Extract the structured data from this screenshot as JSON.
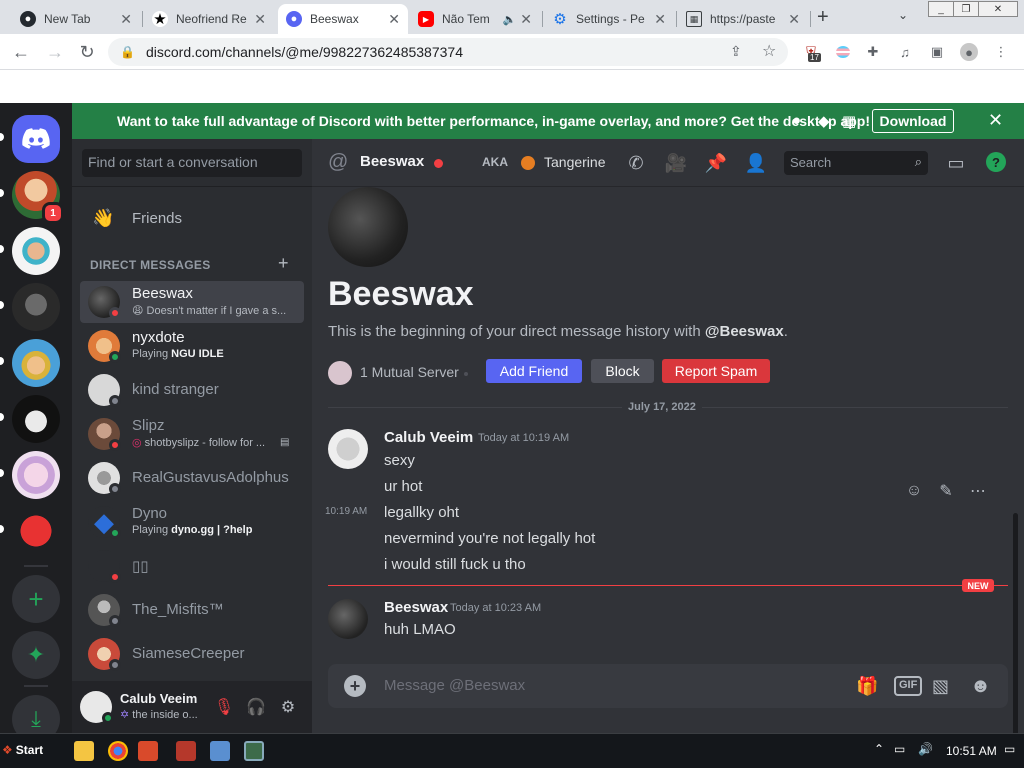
{
  "browser": {
    "tabs": [
      {
        "title": "New Tab",
        "icon": "github-icon",
        "color": "#24292f"
      },
      {
        "title": "Neofriend Re",
        "icon": "star-icon",
        "color": "#000000"
      },
      {
        "title": "Beeswax",
        "icon": "discord-icon",
        "color": "#5865f2"
      },
      {
        "title": "Não Tem",
        "icon": "youtube-icon",
        "color": "#ff0000"
      },
      {
        "title": "Settings - Pe",
        "icon": "gear-icon",
        "color": "#1a73e8"
      },
      {
        "title": "https://paste",
        "icon": "pastebin-icon",
        "color": "#3c4043"
      }
    ],
    "url": "discord.com/channels/@me/998227362485387374",
    "ext_badge": "17"
  },
  "banner": {
    "text": "Want to take full advantage of Discord with better performance, in-game overlay, and more? Get the desktop app!",
    "download": "Download"
  },
  "guilds": {
    "home_icon": "discord-icon",
    "badge": "1",
    "add_icon": "plus-icon",
    "explore_icon": "compass-icon",
    "download_icon": "download-icon"
  },
  "dm_panel": {
    "search_placeholder": "Find or start a conversation",
    "friends_label": "Friends",
    "header": "DIRECT MESSAGES",
    "dms": [
      {
        "name": "Beeswax",
        "sub": "Doesn't matter if I gave a s...",
        "status": "dnd",
        "avatar": "#3a3a3a",
        "selected": true
      },
      {
        "name": "nyxdote",
        "sub_prefix": "Playing",
        "sub_bold": "NGU IDLE",
        "status": "online",
        "avatar": "#e07b3a"
      },
      {
        "name": "kind stranger",
        "status": "offline",
        "avatar": "#d8d8d8"
      },
      {
        "name": "Slipz",
        "sub": "shotbyslipz - follow for ...",
        "status": "dnd",
        "avatar": "#6b4a3a"
      },
      {
        "name": "RealGustavusAdolphus",
        "status": "offline",
        "avatar": "#bfbfbf"
      },
      {
        "name": "Dyno",
        "sub_prefix": "Playing",
        "sub_bold": "dyno.gg | ?help",
        "status": "online",
        "avatar": "#2c6ed9"
      },
      {
        "name": "▯▯",
        "status": "dnd",
        "avatar": "#2b2d31"
      },
      {
        "name": "The_Misfits™",
        "status": "offline",
        "avatar": "#555555"
      },
      {
        "name": "SiameseCreeper",
        "status": "offline",
        "avatar": "#c94a3a"
      }
    ]
  },
  "user_panel": {
    "name": "Calub Veeim",
    "status": "the inside o...",
    "mute_icon": "microphone-muted-icon",
    "deafen_icon": "headphones-icon",
    "settings_icon": "gear-icon"
  },
  "chat": {
    "header": {
      "name": "Beeswax",
      "aka": "AKA",
      "aka_name": "Tangerine",
      "search_placeholder": "Search"
    },
    "welcome": {
      "title": "Beeswax",
      "desc_prefix": "This is the beginning of your direct message history with ",
      "desc_bold": "@Beeswax",
      "desc_suffix": ".",
      "mutual": "1 Mutual Server",
      "add_friend": "Add Friend",
      "block": "Block",
      "report": "Report Spam"
    },
    "date_divider": "July 17, 2022",
    "new_tag": "NEW",
    "hover_time": "10:19 AM",
    "messages": [
      {
        "author": "Calub Veeim",
        "timestamp": "Today at 10:19 AM",
        "lines": [
          "sexy",
          "ur hot",
          "legallky oht",
          "nevermind you're not legally hot",
          "i would still fuck u tho"
        ]
      },
      {
        "author": "Beeswax",
        "timestamp": "Today at 10:23 AM",
        "lines": [
          "huh LMAO"
        ]
      }
    ],
    "composer_placeholder": "Message @Beeswax"
  },
  "taskbar": {
    "start": "Start",
    "clock": "10:51 AM"
  },
  "colors": {
    "blurple": "#5865f2",
    "green": "#248046",
    "red": "#da373c",
    "online": "#23a559",
    "dnd": "#f23f43"
  }
}
